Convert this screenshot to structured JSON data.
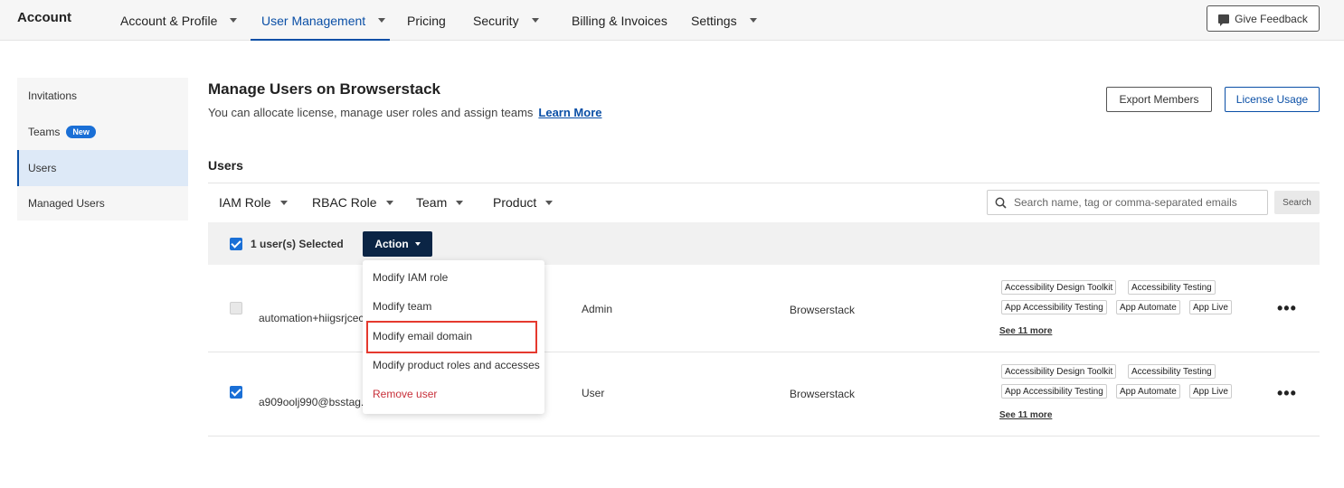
{
  "topbar": {
    "brand": "Account",
    "nav": [
      {
        "label": "Account & Profile"
      },
      {
        "label": "User Management"
      },
      {
        "label": "Pricing"
      },
      {
        "label": "Security"
      },
      {
        "label": "Billing & Invoices"
      },
      {
        "label": "Settings"
      }
    ],
    "feedback_label": "Give Feedback"
  },
  "sidebar": {
    "items": [
      {
        "label": "Invitations"
      },
      {
        "label": "Teams",
        "badge": "New"
      },
      {
        "label": "Users"
      },
      {
        "label": "Managed Users"
      }
    ]
  },
  "header": {
    "title": "Manage Users on Browserstack",
    "subtitle": "You can allocate license, manage user roles and assign teams",
    "learn_more": "Learn More",
    "export_label": "Export Members",
    "license_label": "License Usage"
  },
  "users": {
    "section_title": "Users",
    "filters": [
      "IAM Role",
      "RBAC Role",
      "Team",
      "Product"
    ],
    "search_placeholder": "Search name, tag or comma-separated emails",
    "search_button": "Search",
    "selected_text": "1 user(s) Selected",
    "action_label": "Action",
    "rows": [
      {
        "email": "automation+hiigsrjcec",
        "role": "Admin",
        "team": "Browserstack",
        "tags": [
          "Accessibility Design Toolkit",
          "Accessibility Testing",
          "App Accessibility Testing",
          "App Automate",
          "App Live"
        ],
        "see_more": "See 11 more",
        "checked": false
      },
      {
        "email": "a909oolj990@bsstag.c",
        "role": "User",
        "team": "Browserstack",
        "tags": [
          "Accessibility Design Toolkit",
          "Accessibility Testing",
          "App Accessibility Testing",
          "App Automate",
          "App Live"
        ],
        "see_more": "See 11 more",
        "checked": true
      }
    ]
  },
  "action_menu": {
    "items": [
      {
        "label": "Modify IAM role"
      },
      {
        "label": "Modify team"
      },
      {
        "label": "Modify email domain"
      },
      {
        "label": "Modify product roles and accesses"
      },
      {
        "label": "Remove user"
      }
    ]
  },
  "colors": {
    "accent": "#0a4fa6",
    "action_button": "#0b2545",
    "danger": "#c8303a",
    "highlight": "#e5392e"
  }
}
